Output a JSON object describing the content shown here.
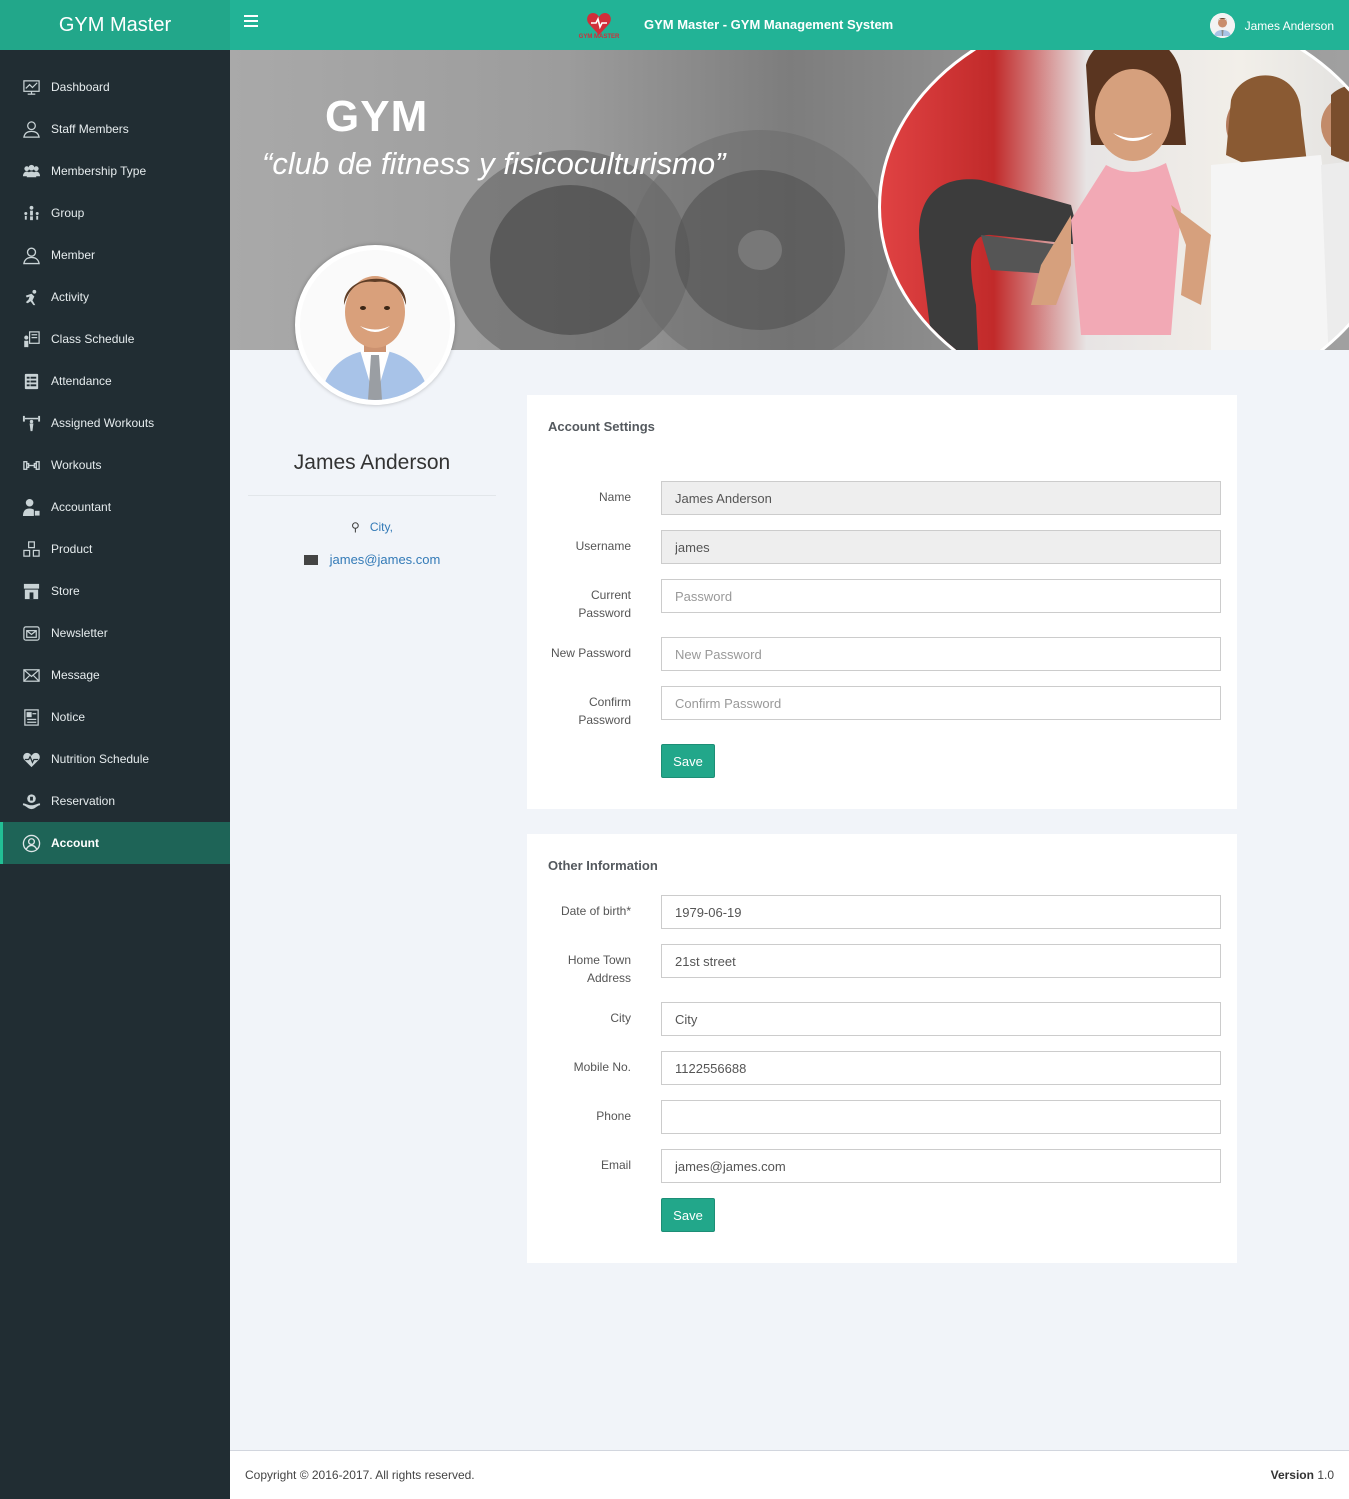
{
  "app": {
    "brand": "GYM Master",
    "system_title": "GYM Master - GYM Management System",
    "logo_text": "GYM MASTER"
  },
  "user": {
    "name": "James Anderson"
  },
  "sidebar": {
    "items": [
      {
        "label": "Dashboard",
        "icon": "dashboard-icon"
      },
      {
        "label": "Staff Members",
        "icon": "staff-icon"
      },
      {
        "label": "Membership Type",
        "icon": "membership-icon"
      },
      {
        "label": "Group",
        "icon": "group-icon"
      },
      {
        "label": "Member",
        "icon": "member-icon"
      },
      {
        "label": "Activity",
        "icon": "activity-icon"
      },
      {
        "label": "Class Schedule",
        "icon": "class-schedule-icon"
      },
      {
        "label": "Attendance",
        "icon": "attendance-icon"
      },
      {
        "label": "Assigned Workouts",
        "icon": "assigned-workouts-icon"
      },
      {
        "label": "Workouts",
        "icon": "workouts-icon"
      },
      {
        "label": "Accountant",
        "icon": "accountant-icon"
      },
      {
        "label": "Product",
        "icon": "product-icon"
      },
      {
        "label": "Store",
        "icon": "store-icon"
      },
      {
        "label": "Newsletter",
        "icon": "newsletter-icon"
      },
      {
        "label": "Message",
        "icon": "message-icon"
      },
      {
        "label": "Notice",
        "icon": "notice-icon"
      },
      {
        "label": "Nutrition Schedule",
        "icon": "nutrition-icon"
      },
      {
        "label": "Reservation",
        "icon": "reservation-icon"
      },
      {
        "label": "Account",
        "icon": "account-icon",
        "active": true
      }
    ]
  },
  "banner": {
    "heading": "GYM",
    "tagline": "“club de fitness y fisicoculturismo”"
  },
  "profile": {
    "name": "James Anderson",
    "city": "City,",
    "email": "james@james.com"
  },
  "account_settings": {
    "title": "Account Settings",
    "name_label": "Name",
    "name_value": "James Anderson",
    "username_label": "Username",
    "username_value": "james",
    "current_password_label_1": "Current",
    "current_password_label_2": "Password",
    "current_password_placeholder": "Password",
    "new_password_label": "New Password",
    "new_password_placeholder": "New Password",
    "confirm_password_label_1": "Confirm",
    "confirm_password_label_2": "Password",
    "confirm_password_placeholder": "Confirm Password",
    "save_label": "Save"
  },
  "other_info": {
    "title": "Other Information",
    "dob_label": "Date of birth*",
    "dob_value": "1979-06-19",
    "hometown_label_1": "Home Town",
    "hometown_label_2": "Address",
    "hometown_value": "21st street",
    "city_label": "City",
    "city_value": "City",
    "mobile_label": "Mobile No.",
    "mobile_value": "1122556688",
    "phone_label": "Phone",
    "phone_value": "",
    "email_label": "Email",
    "email_value": "james@james.com",
    "save_label": "Save"
  },
  "footer": {
    "copyright": "Copyright © 2016-2017. All rights reserved.",
    "version_label": "Version",
    "version_value": "1.0"
  },
  "colors": {
    "brand_green": "#22b396",
    "sidebar_bg": "#212d33",
    "active_item_bg": "#1e6457",
    "link_blue": "#337ab7"
  }
}
